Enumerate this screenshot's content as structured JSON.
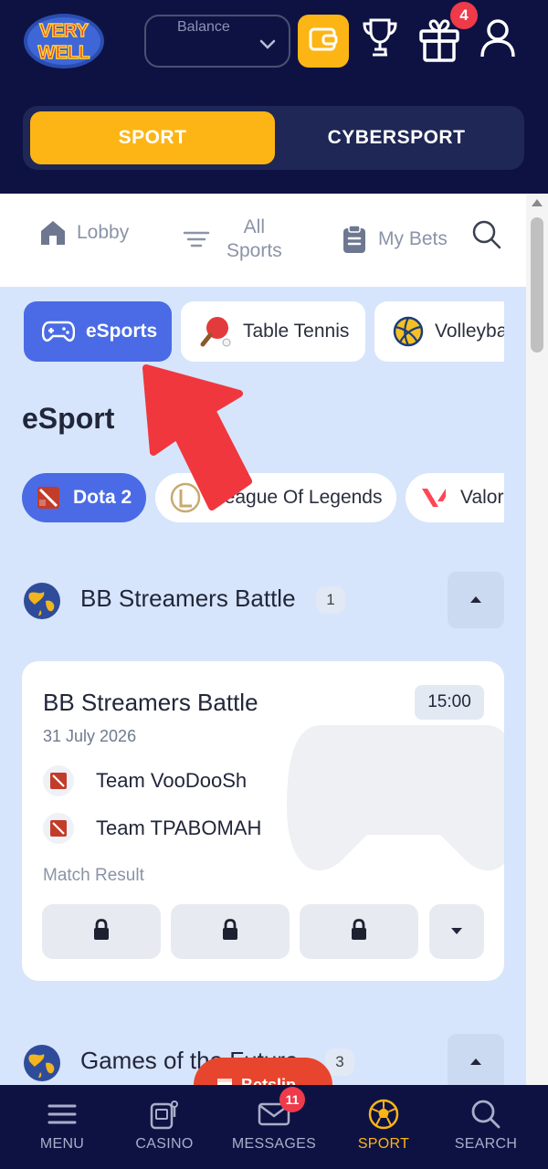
{
  "header": {
    "logo_text": [
      "VERY",
      "WELL"
    ],
    "balance_label": "Balance",
    "gift_badge": "4"
  },
  "mode_switch": {
    "sport_label": "SPORT",
    "cybersport_label": "CYBERSPORT",
    "active": "SPORT"
  },
  "nav": {
    "lobby": "Lobby",
    "all_sports_line1": "All",
    "all_sports_line2": "Sports",
    "my_bets": "My Bets"
  },
  "sports": [
    {
      "label": "eSports",
      "icon": "gamepad-icon",
      "active": true
    },
    {
      "label": "Table Tennis",
      "icon": "ping-pong-icon",
      "active": false
    },
    {
      "label": "Volleyba",
      "icon": "volleyball-icon",
      "active": false
    }
  ],
  "section_title": "eSport",
  "games": [
    {
      "label": "Dota 2",
      "icon": "dota-icon",
      "active": true
    },
    {
      "label": "League Of Legends",
      "icon": "lol-icon",
      "active": false
    },
    {
      "label": "Valor",
      "icon": "valorant-icon",
      "active": false
    }
  ],
  "tournaments": [
    {
      "name": "BB Streamers Battle",
      "count": "1"
    },
    {
      "name": "Games of the Future",
      "count": "3"
    }
  ],
  "event": {
    "title": "BB Streamers Battle",
    "time": "15:00",
    "date": "31 July 2026",
    "team1": "Team VooDooSh",
    "team2": "Team TPABOMAH",
    "market": "Match Result"
  },
  "betslip_label": "Betslip",
  "bottom_nav": [
    {
      "label": "MENU",
      "icon": "hamburger-icon",
      "active": false
    },
    {
      "label": "CASINO",
      "icon": "slot-machine-icon",
      "active": false
    },
    {
      "label": "MESSAGES",
      "icon": "envelope-icon",
      "active": false
    },
    {
      "label": "SPORT",
      "icon": "soccer-ball-icon",
      "active": true
    },
    {
      "label": "SEARCH",
      "icon": "search-icon",
      "active": false
    }
  ],
  "messages_badge": "11",
  "colors": {
    "header_bg": "#0e1243",
    "accent_yellow": "#fdb515",
    "active_blue": "#4a6be5",
    "content_bg": "#d6e5fb",
    "badge_red": "#ef3a4a"
  }
}
